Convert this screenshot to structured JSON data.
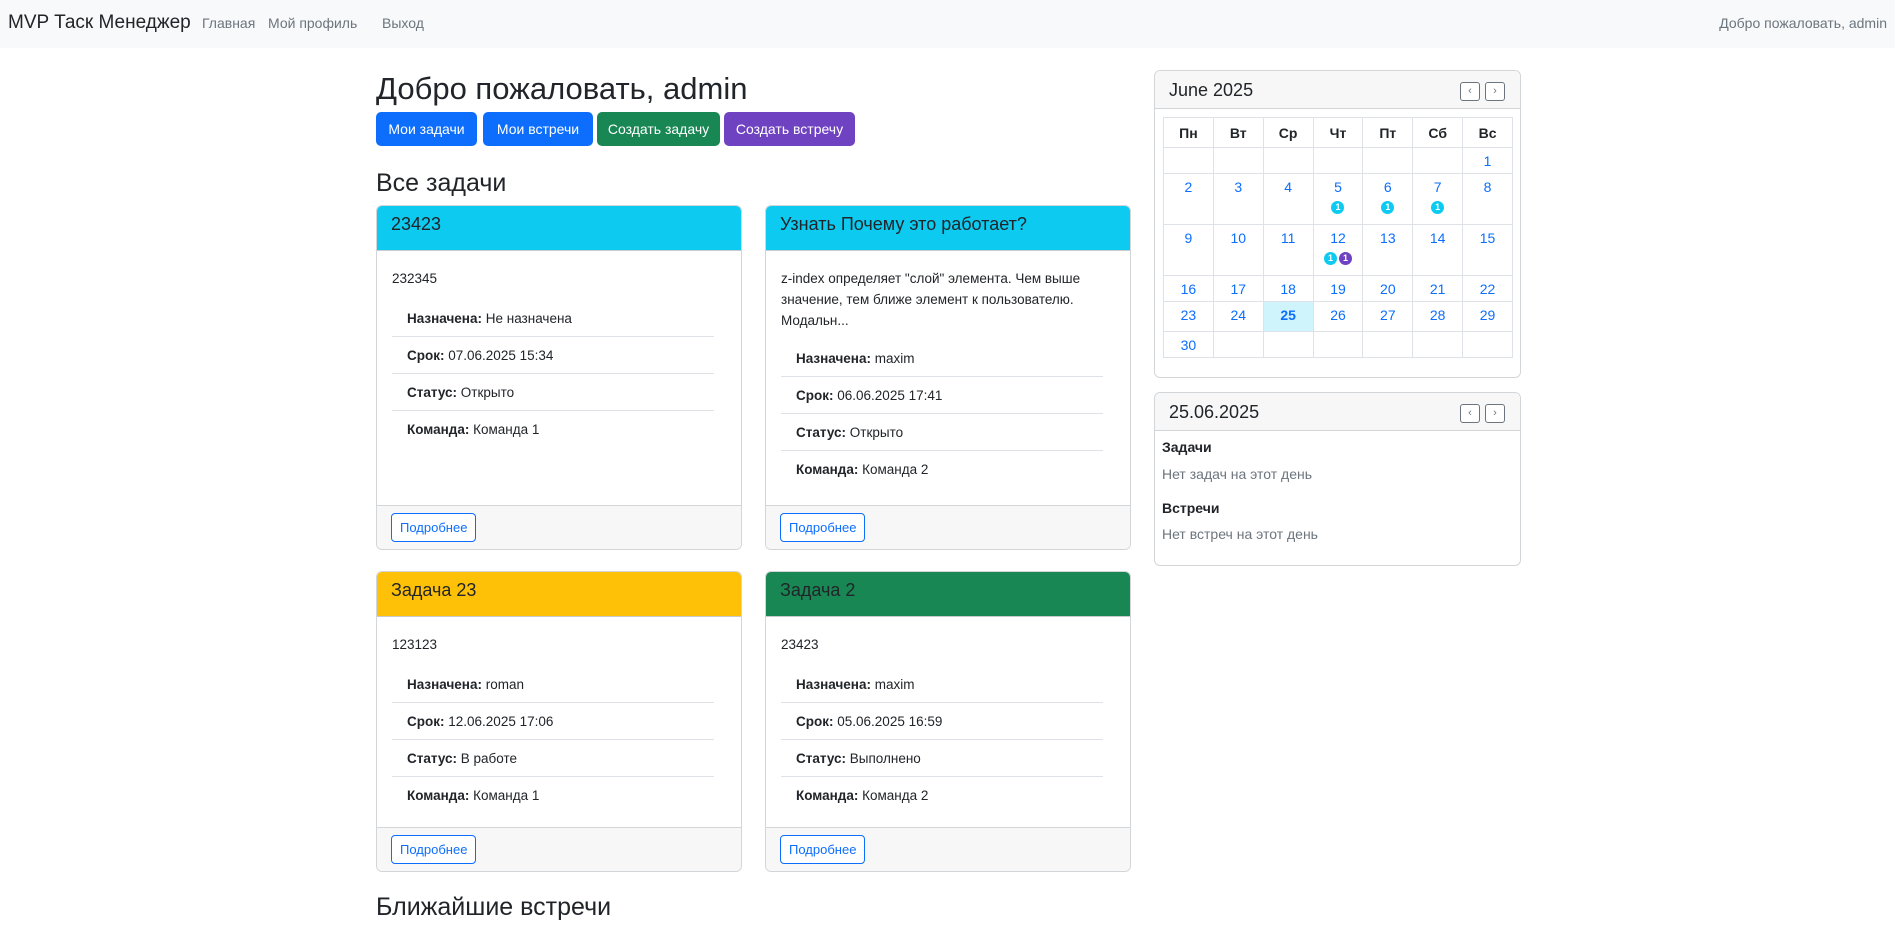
{
  "nav": {
    "brand": "MVP Таск Менеджер",
    "links": [
      "Главная",
      "Мой профиль",
      "Выход"
    ],
    "welcome": "Добро пожаловать, admin"
  },
  "page": {
    "title": "Добро пожаловать, admin",
    "buttons": {
      "my_tasks": "Мои задачи",
      "my_meetings": "Мои встречи",
      "create_task": "Создать задачу",
      "create_meeting": "Создать встречу"
    },
    "all_tasks_title": "Все задачи",
    "upcoming_meetings_title": "Ближайшие встречи"
  },
  "colors": {
    "info": "#0dcaf0",
    "warning": "#ffc107",
    "success": "#198754",
    "primary": "#0d6efd",
    "purple": "#6f42c1"
  },
  "labels": {
    "assigned": "Назначена:",
    "deadline": "Срок:",
    "status": "Статус:",
    "team": "Команда:",
    "details": "Подробнее"
  },
  "tasks": [
    {
      "title": "23423",
      "description": "232345",
      "assigned": "Не назначена",
      "deadline": "07.06.2025 15:34",
      "status": "Открыто",
      "team": "Команда 1",
      "color": "info"
    },
    {
      "title": "Узнать Почему это работает?",
      "description": "z-index определяет \"слой\" элемента. Чем выше значение, тем ближе элемент к пользователю. Модальн...",
      "assigned": "maxim",
      "deadline": "06.06.2025 17:41",
      "status": "Открыто",
      "team": "Команда 2",
      "color": "info"
    },
    {
      "title": "Задача 23",
      "description": "123123",
      "assigned": "roman",
      "deadline": "12.06.2025 17:06",
      "status": "В работе",
      "team": "Команда 1",
      "color": "warning"
    },
    {
      "title": "Задача 2",
      "description": "23423",
      "assigned": "maxim",
      "deadline": "05.06.2025 16:59",
      "status": "Выполнено",
      "team": "Команда 2",
      "color": "success"
    }
  ],
  "calendar": {
    "month": "June 2025",
    "prev": "‹",
    "next": "›",
    "weekdays": [
      "Пн",
      "Вт",
      "Ср",
      "Чт",
      "Пт",
      "Сб",
      "Вс"
    ],
    "weeks": [
      [
        "",
        "",
        "",
        "",
        "",
        "",
        "1"
      ],
      [
        "2",
        "3",
        "4",
        "5",
        "6",
        "7",
        "8"
      ],
      [
        "9",
        "10",
        "11",
        "12",
        "13",
        "14",
        "15"
      ],
      [
        "16",
        "17",
        "18",
        "19",
        "20",
        "21",
        "22"
      ],
      [
        "23",
        "24",
        "25",
        "26",
        "27",
        "28",
        "29"
      ],
      [
        "30",
        "",
        "",
        "",
        "",
        "",
        ""
      ]
    ],
    "today": "25",
    "badges": {
      "5": [
        {
          "count": "1",
          "type": "info"
        }
      ],
      "6": [
        {
          "count": "1",
          "type": "info"
        }
      ],
      "7": [
        {
          "count": "1",
          "type": "info"
        }
      ],
      "12": [
        {
          "count": "1",
          "type": "info"
        },
        {
          "count": "1",
          "type": "purple"
        }
      ]
    }
  },
  "day": {
    "date": "25.06.2025",
    "prev": "‹",
    "next": "›",
    "tasks_title": "Задачи",
    "tasks_empty": "Нет задач на этот день",
    "meetings_title": "Встречи",
    "meetings_empty": "Нет встреч на этот день"
  }
}
